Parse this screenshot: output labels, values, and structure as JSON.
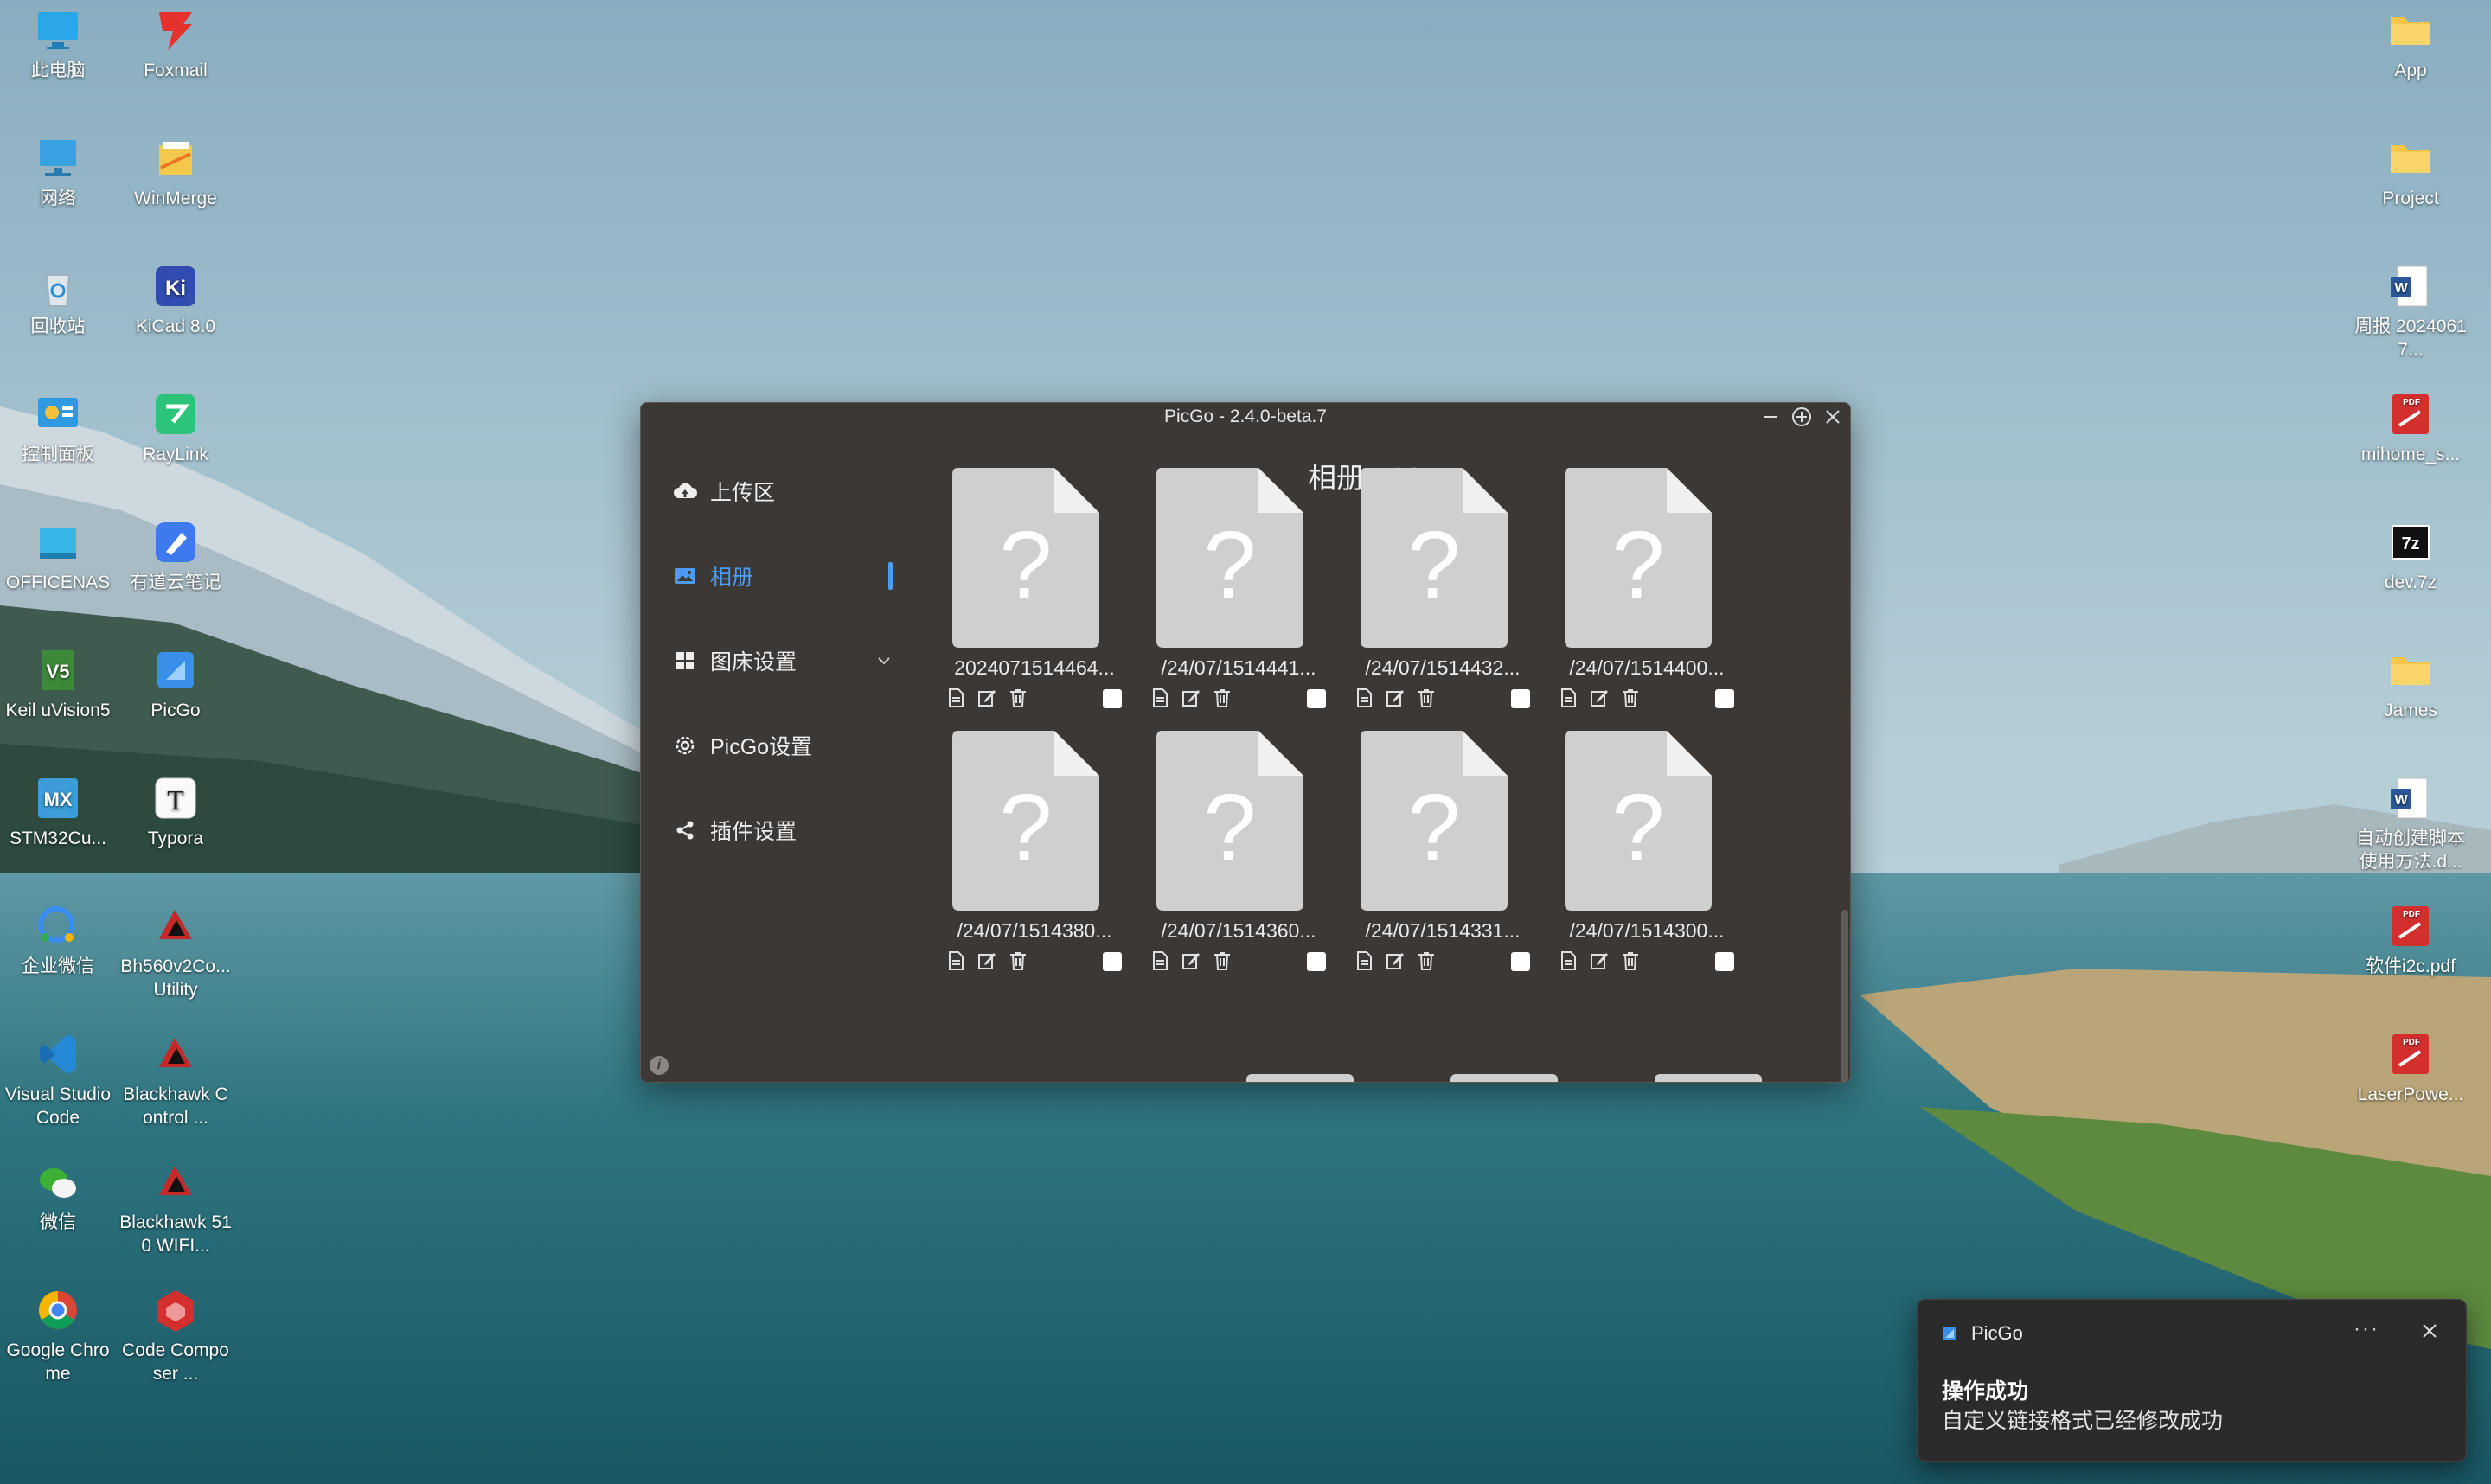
{
  "desktop": {
    "left_icons": [
      {
        "label": "此电脑",
        "icon": "monitor-icon"
      },
      {
        "label": "Foxmail",
        "icon": "foxmail-icon"
      },
      {
        "label": "网络",
        "icon": "network-icon"
      },
      {
        "label": "WinMerge",
        "icon": "winmerge-icon"
      },
      {
        "label": "回收站",
        "icon": "recycle-bin-icon"
      },
      {
        "label": "KiCad 8.0",
        "icon": "kicad-icon"
      },
      {
        "label": "控制面板",
        "icon": "control-panel-icon"
      },
      {
        "label": "RayLink",
        "icon": "raylink-icon"
      },
      {
        "label": "OFFICENAS",
        "icon": "officenas-icon"
      },
      {
        "label": "有道云笔记",
        "icon": "youdao-note-icon"
      },
      {
        "label": "Keil uVision5",
        "icon": "keil-icon"
      },
      {
        "label": "PicGo",
        "icon": "picgo-icon"
      },
      {
        "label": "STM32Cu...",
        "icon": "stm32cube-icon"
      },
      {
        "label": "Typora",
        "icon": "typora-icon"
      },
      {
        "label": "企业微信",
        "icon": "wecom-icon"
      },
      {
        "label": "Bh560v2Co... Utility",
        "icon": "blackhawk-icon"
      },
      {
        "label": "Visual Studio Code",
        "icon": "vscode-icon"
      },
      {
        "label": "Blackhawk Control ...",
        "icon": "blackhawk-icon"
      },
      {
        "label": "微信",
        "icon": "wechat-icon"
      },
      {
        "label": "Blackhawk 510 WIFI...",
        "icon": "blackhawk-lan-icon"
      },
      {
        "label": "Google Chrome",
        "icon": "chrome-icon"
      },
      {
        "label": "Code Composer ...",
        "icon": "code-composer-icon"
      }
    ],
    "right_icons": [
      {
        "label": "App",
        "icon": "folder-icon"
      },
      {
        "label": "Project",
        "icon": "folder-icon"
      },
      {
        "label": "周报 20240617...",
        "icon": "word-doc-icon"
      },
      {
        "label": "mihome_s...",
        "icon": "pdf-icon"
      },
      {
        "label": "dev.7z",
        "icon": "7z-archive-icon"
      },
      {
        "label": "James",
        "icon": "folder-icon"
      },
      {
        "label": "自动创建脚本使用方法.d...",
        "icon": "word-doc-icon"
      },
      {
        "label": "软件i2c.pdf",
        "icon": "pdf-icon"
      },
      {
        "label": "LaserPowe...",
        "icon": "pdf-icon"
      }
    ]
  },
  "picgo": {
    "window_title": "PicGo - 2.4.0-beta.7",
    "nav": [
      {
        "label": "上传区",
        "icon": "cloud-upload-icon"
      },
      {
        "label": "相册",
        "icon": "image-icon"
      },
      {
        "label": "图床设置",
        "icon": "grid-icon"
      },
      {
        "label": "PicGo设置",
        "icon": "gear-icon"
      },
      {
        "label": "插件设置",
        "icon": "share-icon"
      }
    ],
    "album_title": "相册 - 20",
    "images": [
      {
        "name": "2024071514464..."
      },
      {
        "name": "/24/07/1514441..."
      },
      {
        "name": "/24/07/1514432..."
      },
      {
        "name": "/24/07/1514400..."
      },
      {
        "name": "/24/07/1514380..."
      },
      {
        "name": "/24/07/1514360..."
      },
      {
        "name": "/24/07/1514331..."
      },
      {
        "name": "/24/07/1514300..."
      }
    ],
    "colors": {
      "accent": "#4a9cf5",
      "window_bg": "#3b3836"
    }
  },
  "toast": {
    "app_name": "PicGo",
    "more": "···",
    "title": "操作成功",
    "message": "自定义链接格式已经修改成功"
  }
}
